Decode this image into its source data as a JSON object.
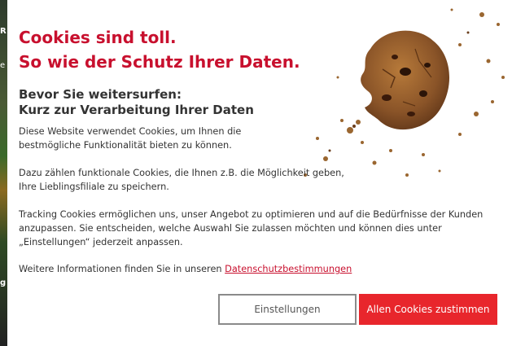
{
  "headline": {
    "line1": "Cookies sind toll.",
    "line2": "So wie der Schutz Ihrer Daten."
  },
  "subheadline": {
    "line1": "Bevor Sie weitersurfen:",
    "line2": "Kurz zur Verarbeitung Ihrer Daten"
  },
  "paragraphs": {
    "p1": "Diese Website verwendet Cookies, um Ihnen die bestmögliche Funktionalität bieten zu können.",
    "p2": "Dazu zählen funktionale Cookies, die Ihnen z.B. die Möglichkeit geben, Ihre Lieblingsfiliale zu speichern.",
    "p3": "Tracking Cookies ermöglichen uns, unser Angebot zu optimieren und auf die Bedürfnisse der Kunden anzupassen. Sie entscheiden, welche Auswahl Sie zulassen möchten und können dies unter „Einstellungen“ jederzeit anpassen.",
    "p4_prefix": "Weitere Informationen finden Sie in unseren ",
    "p4_link": "Datenschutzbestimmungen"
  },
  "buttons": {
    "settings": "Einstellungen",
    "accept": "Allen Cookies zustimmen"
  },
  "background": {
    "left_fragments": [
      "R",
      "e",
      "g"
    ]
  },
  "colors": {
    "accent": "#c8102e",
    "button_accept": "#e8262c"
  },
  "icons": {
    "cookie": "cookie-illustration"
  }
}
